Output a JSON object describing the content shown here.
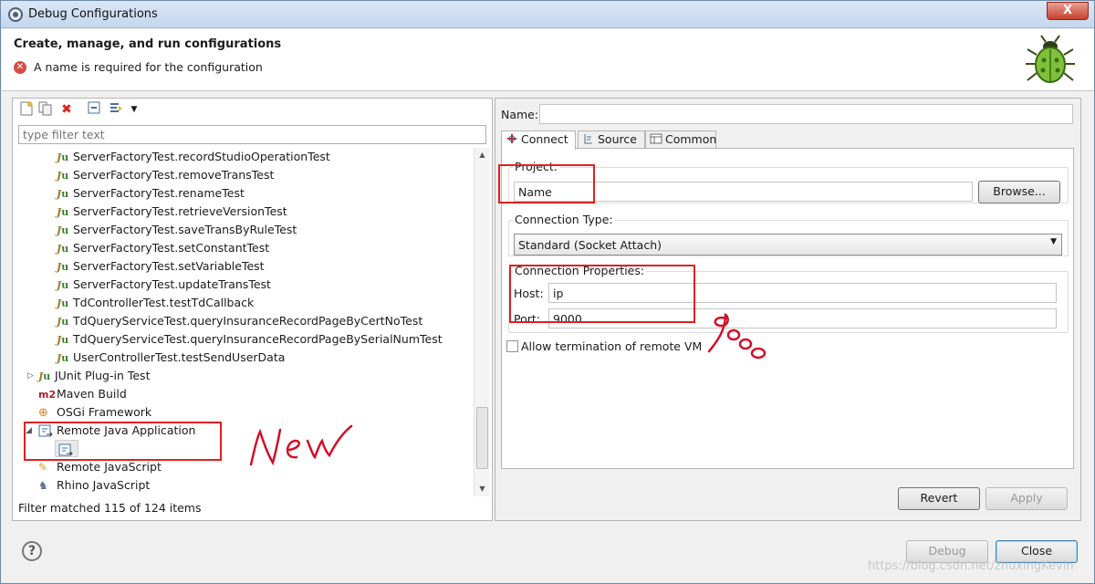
{
  "window": {
    "title": "Debug Configurations",
    "close_glyph": "X"
  },
  "header": {
    "title": "Create, manage, and run configurations",
    "message": "A name is required for the configuration",
    "error_icon": "error-icon",
    "logo_icon": "bug-icon"
  },
  "left": {
    "toolbar_icons": [
      "new-launch-configuration-icon",
      "duplicate-icon",
      "delete-icon",
      "collapse-all-icon",
      "filter-icon",
      "view-menu-chevron-icon"
    ],
    "filter_placeholder": "type filter text",
    "tree_items": [
      {
        "label": "ServerFactoryTest.recordStudioOperationTest",
        "icon": "junit-test-icon",
        "level": 2
      },
      {
        "label": "ServerFactoryTest.removeTransTest",
        "icon": "junit-test-icon",
        "level": 2
      },
      {
        "label": "ServerFactoryTest.renameTest",
        "icon": "junit-test-icon",
        "level": 2
      },
      {
        "label": "ServerFactoryTest.retrieveVersionTest",
        "icon": "junit-test-icon",
        "level": 2
      },
      {
        "label": "ServerFactoryTest.saveTransByRuleTest",
        "icon": "junit-test-icon",
        "level": 2
      },
      {
        "label": "ServerFactoryTest.setConstantTest",
        "icon": "junit-test-icon",
        "level": 2
      },
      {
        "label": "ServerFactoryTest.setVariableTest",
        "icon": "junit-test-icon",
        "level": 2
      },
      {
        "label": "ServerFactoryTest.updateTransTest",
        "icon": "junit-test-icon",
        "level": 2
      },
      {
        "label": "TdControllerTest.testTdCallback",
        "icon": "junit-test-icon",
        "level": 2
      },
      {
        "label": "TdQueryServiceTest.queryInsuranceRecordPageByCertNoTest",
        "icon": "junit-test-icon",
        "level": 2
      },
      {
        "label": "TdQueryServiceTest.queryInsuranceRecordPageBySerialNumTest",
        "icon": "junit-test-icon",
        "level": 2
      },
      {
        "label": "UserControllerTest.testSendUserData",
        "icon": "junit-test-icon",
        "level": 2
      },
      {
        "label": "JUnit Plug-in Test",
        "icon": "junit-plugin-icon",
        "level": 1
      },
      {
        "label": "Maven Build",
        "icon": "maven-icon",
        "level": 1,
        "expander": "▷"
      },
      {
        "label": "OSGi Framework",
        "icon": "osgi-icon",
        "level": 1
      },
      {
        "label": "Remote Java Application",
        "icon": "remote-java-icon",
        "level": 1,
        "expander": "◢"
      },
      {
        "label": "",
        "icon": "new-remote-java-config-icon",
        "level": 2
      },
      {
        "label": "Remote JavaScript",
        "icon": "remote-javascript-icon",
        "level": 1
      },
      {
        "label": "Rhino JavaScript",
        "icon": "rhino-icon",
        "level": 1
      }
    ],
    "filter_status": "Filter matched 115 of 124 items"
  },
  "right": {
    "name_label": "Name:",
    "name_value": "",
    "tabs": [
      {
        "label": "Connect",
        "icon": "connect-icon"
      },
      {
        "label": "Source",
        "icon": "source-icon"
      },
      {
        "label": "Common",
        "icon": "common-icon"
      }
    ],
    "project_label": "Project:",
    "project_value": "Name",
    "browse_label": "Browse...",
    "connection_type_label": "Connection Type:",
    "connection_type_value": "Standard (Socket Attach)",
    "connection_properties_label": "Connection Properties:",
    "host_label": "Host:",
    "host_value": "ip",
    "port_label": "Port:",
    "port_value": "9000",
    "allow_termination_label": "Allow termination of remote VM",
    "allow_termination_checked": false,
    "revert_label": "Revert",
    "apply_label": "Apply"
  },
  "footer": {
    "debug_label": "Debug",
    "close_label": "Close",
    "help_glyph": "?",
    "watermark": "https://blog.csdn.net/zhuxingKevin"
  },
  "annotations": {
    "handwritten_new": "New",
    "handwritten_port": "9000"
  },
  "colors": {
    "annotation_red": "#e02020",
    "annotation_ink": "#d0102a"
  }
}
